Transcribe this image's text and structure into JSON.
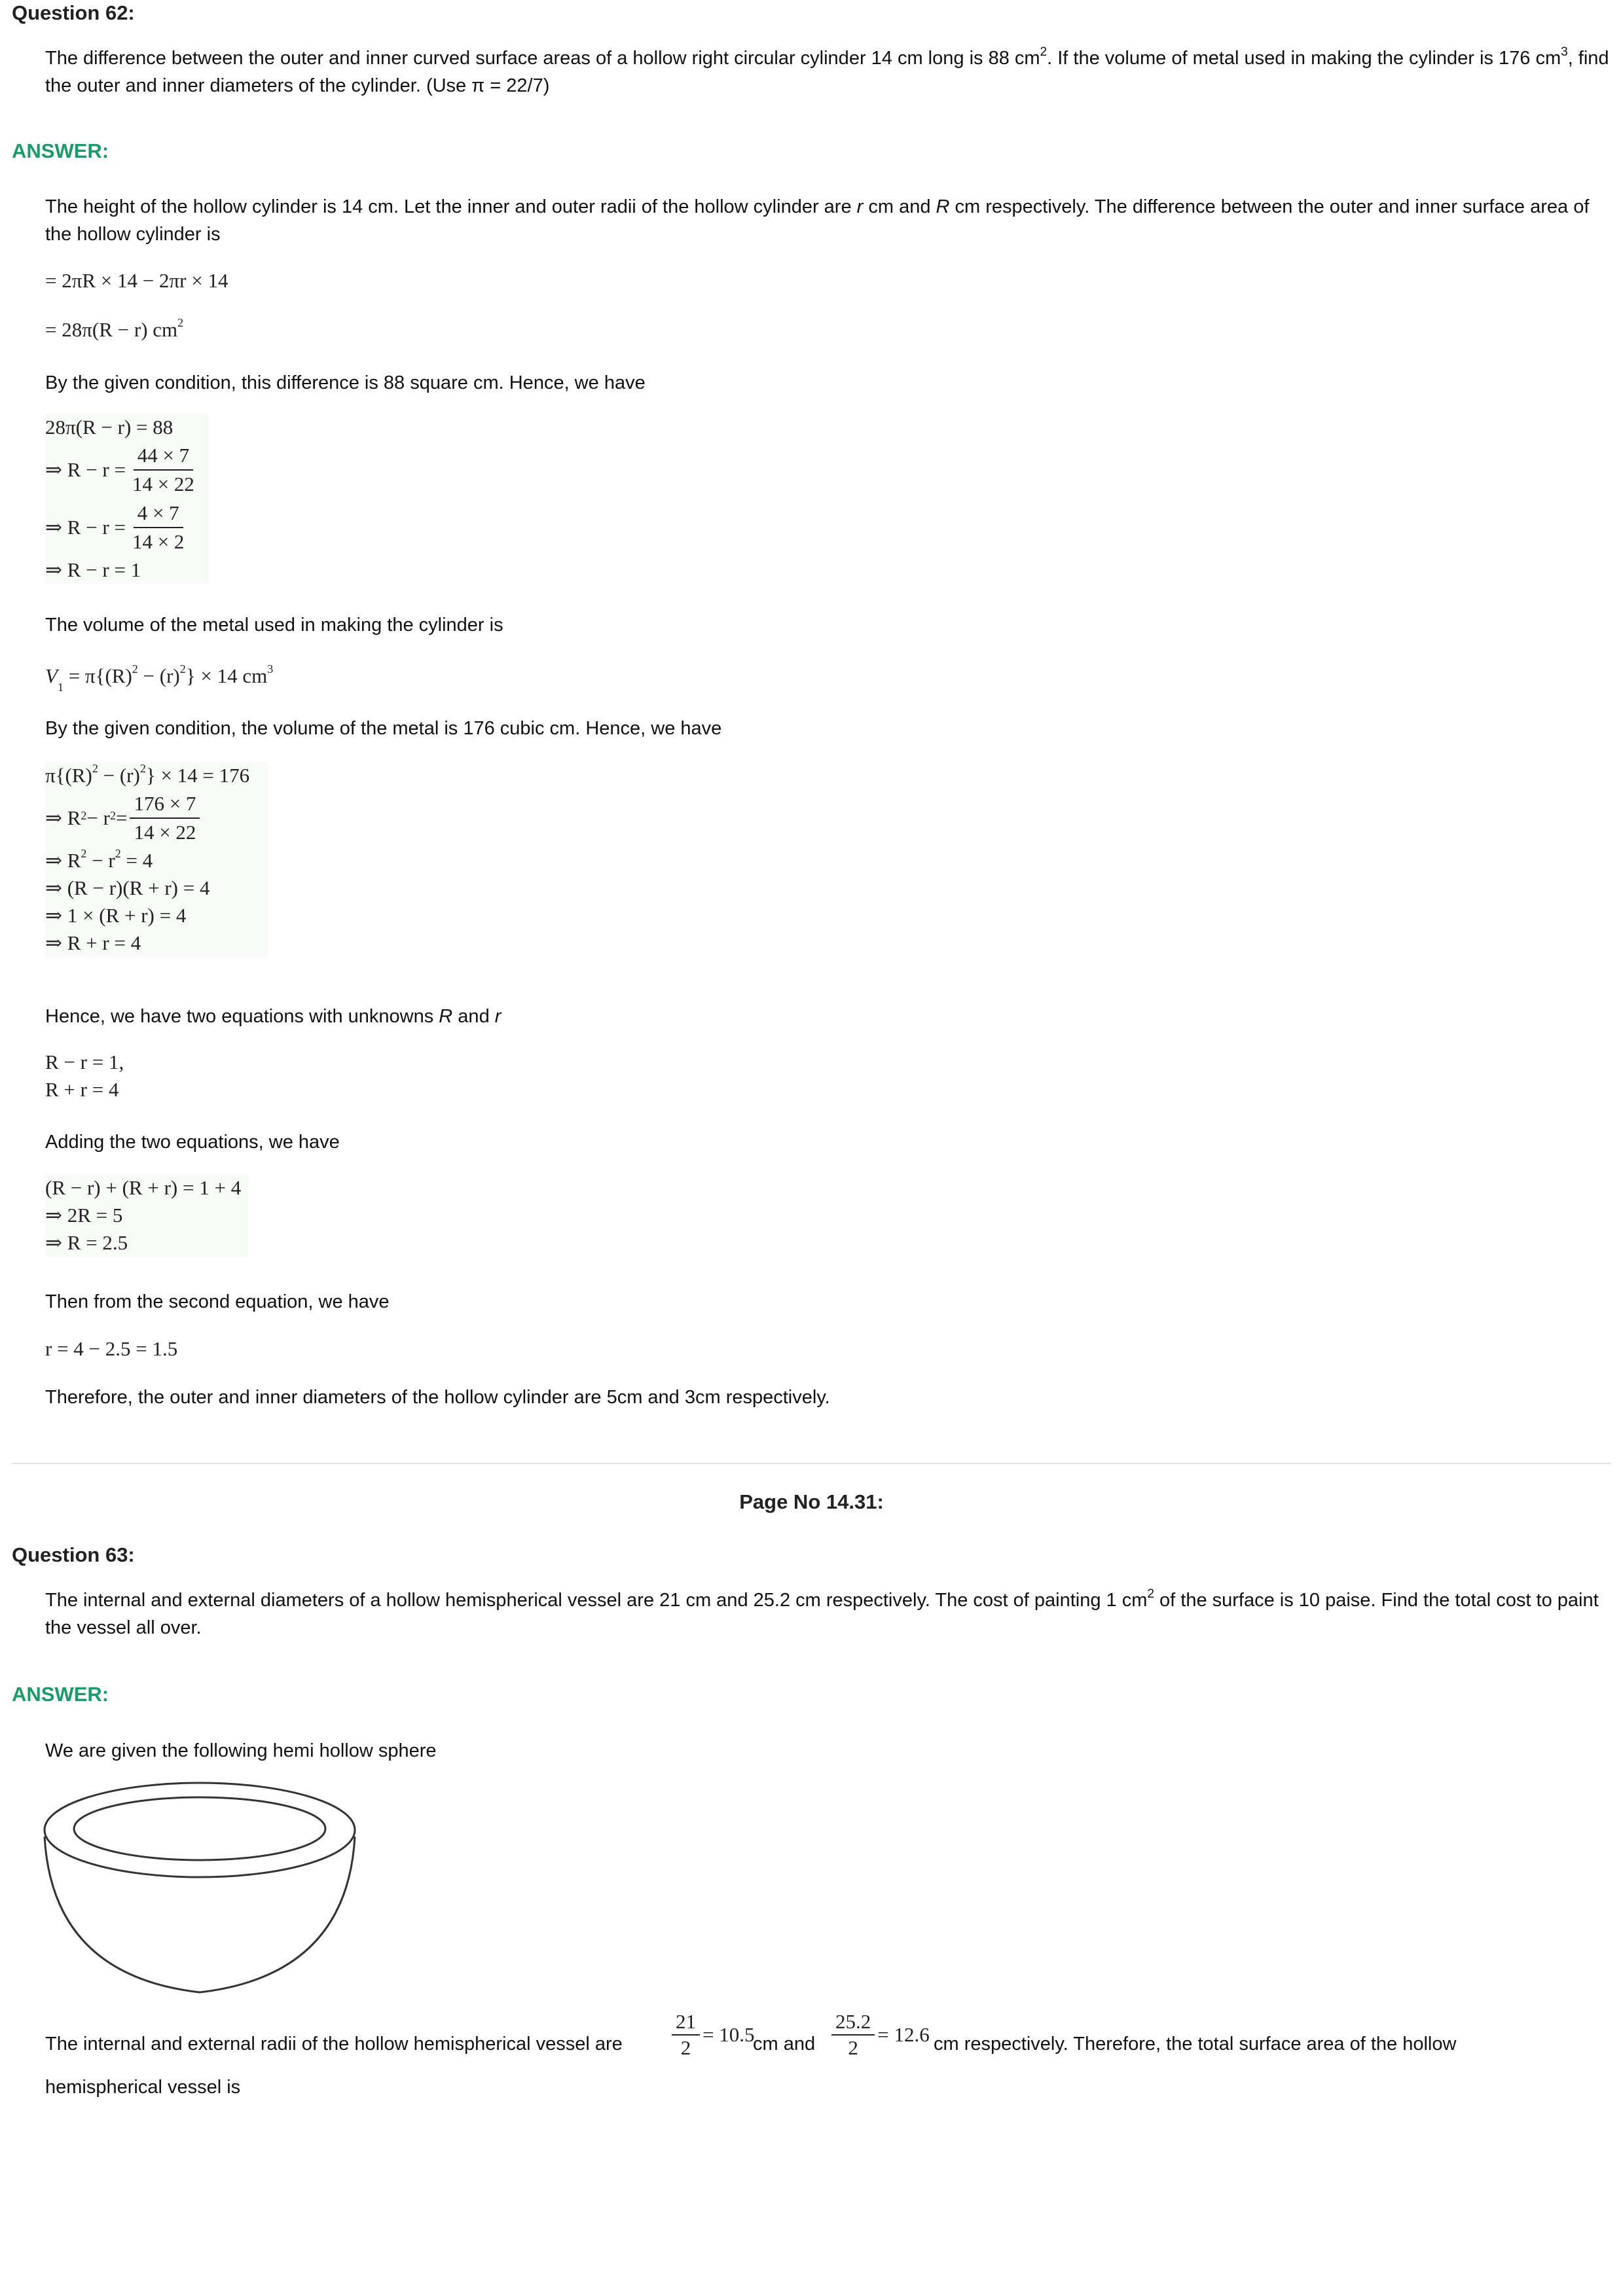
{
  "q62": {
    "title": "Question 62:",
    "text_a": "The difference between the outer and inner curved surface areas of a hollow right circular cylinder 14 cm long is 88 cm",
    "sup_a": "2",
    "text_b": ". If the volume of metal used in making the cylinder is 176 cm",
    "sup_b": "3",
    "text_c": ", find the outer and inner diameters of the cylinder. (Use π = 22/7)"
  },
  "a62": {
    "label": "ANSWER:",
    "intro_1": "The height of the hollow cylinder is 14 cm. Let the inner and outer radii of the hollow cylinder are ",
    "intro_r": "r",
    "intro_2": " cm and ",
    "intro_R": "R",
    "intro_3": " cm respectively. The difference between the outer and inner surface area of the hollow cylinder is",
    "eq_diff_1": "= 2πR × 14 − 2πr × 14",
    "eq_diff_2": "= 28π(R − r) cm",
    "eq_diff_2_sup": "2",
    "cond_1": "By the given condition, this difference is 88 square cm. Hence, we have",
    "s1_l1": "28π(R − r) = 88",
    "s1_l2_pre": "⇒ R − r = ",
    "s1_l2_num": "44 × 7",
    "s1_l2_den": "14 × 22",
    "s1_l3_pre": "⇒ R − r = ",
    "s1_l3_num": "4 × 7",
    "s1_l3_den": "14 × 2",
    "s1_l4": "⇒ R − r = 1",
    "vol_intro": "The volume of the metal used in making the cylinder is",
    "vol_eq_a": "V",
    "vol_eq_sub": "1",
    "vol_eq_b": " = π{(R)",
    "vol_eq_sup1": "2",
    "vol_eq_c": " − (r)",
    "vol_eq_sup2": "2",
    "vol_eq_d": "} × 14 cm",
    "vol_eq_sup3": "3",
    "cond_2": "By the given condition, the volume of the metal is 176 cubic cm. Hence, we have",
    "s2_l1_a": "π{(R)",
    "s2_l1_sup1": "2",
    "s2_l1_b": " − (r)",
    "s2_l1_sup2": "2",
    "s2_l1_c": "} × 14 = 176",
    "s2_l2_pre_a": "⇒ R",
    "s2_l2_sup1": "2",
    "s2_l2_pre_b": " − r",
    "s2_l2_sup2": "2",
    "s2_l2_pre_c": " = ",
    "s2_l2_num": "176 × 7",
    "s2_l2_den": "14 × 22",
    "s2_l3_a": "⇒ R",
    "s2_l3_sup1": "2",
    "s2_l3_b": " − r",
    "s2_l3_sup2": "2",
    "s2_l3_c": " = 4",
    "s2_l4": "⇒ (R − r)(R + r) = 4",
    "s2_l5": "⇒ 1 × (R + r) = 4",
    "s2_l6": "⇒ R + r = 4",
    "two_eq_1": "Hence, we have two equations with unknowns ",
    "two_eq_R": "R",
    "two_eq_2": " and ",
    "two_eq_r": "r",
    "pair_l1": "R − r = 1,",
    "pair_l2": "R + r = 4",
    "adding": "Adding the two equations, we have",
    "add_l1": "(R − r) + (R + r) = 1 + 4",
    "add_l2": "⇒ 2R = 5",
    "add_l3": "⇒ R = 2.5",
    "second": "Then from the second equation, we have",
    "r_eq": "r = 4 − 2.5 = 1.5",
    "conclusion": "Therefore, the outer and inner diameters of the hollow cylinder are 5cm and 3cm respectively."
  },
  "page_no": "Page No 14.31:",
  "q63": {
    "title": "Question 63:",
    "text_a": "The internal and external diameters of a hollow hemispherical vessel are 21 cm and 25.2 cm respectively. The cost of painting 1 cm",
    "sup_a": "2",
    "text_b": " of the surface is 10 paise. Find the total cost to paint the vessel all over."
  },
  "a63": {
    "label": "ANSWER:",
    "given": "We are given the following hemi hollow sphere",
    "radii_1": "The internal and external radii of the hollow hemispherical vessel are",
    "f1_num": "21",
    "f1_den": "2",
    "f1_res": "= 10.5",
    "radii_2": "cm and",
    "f2_num": "25.2",
    "f2_den": "2",
    "f2_res": "= 12.6",
    "radii_3": "cm respectively. Therefore, the total surface area of the hollow",
    "radii_4": "hemispherical vessel is"
  }
}
